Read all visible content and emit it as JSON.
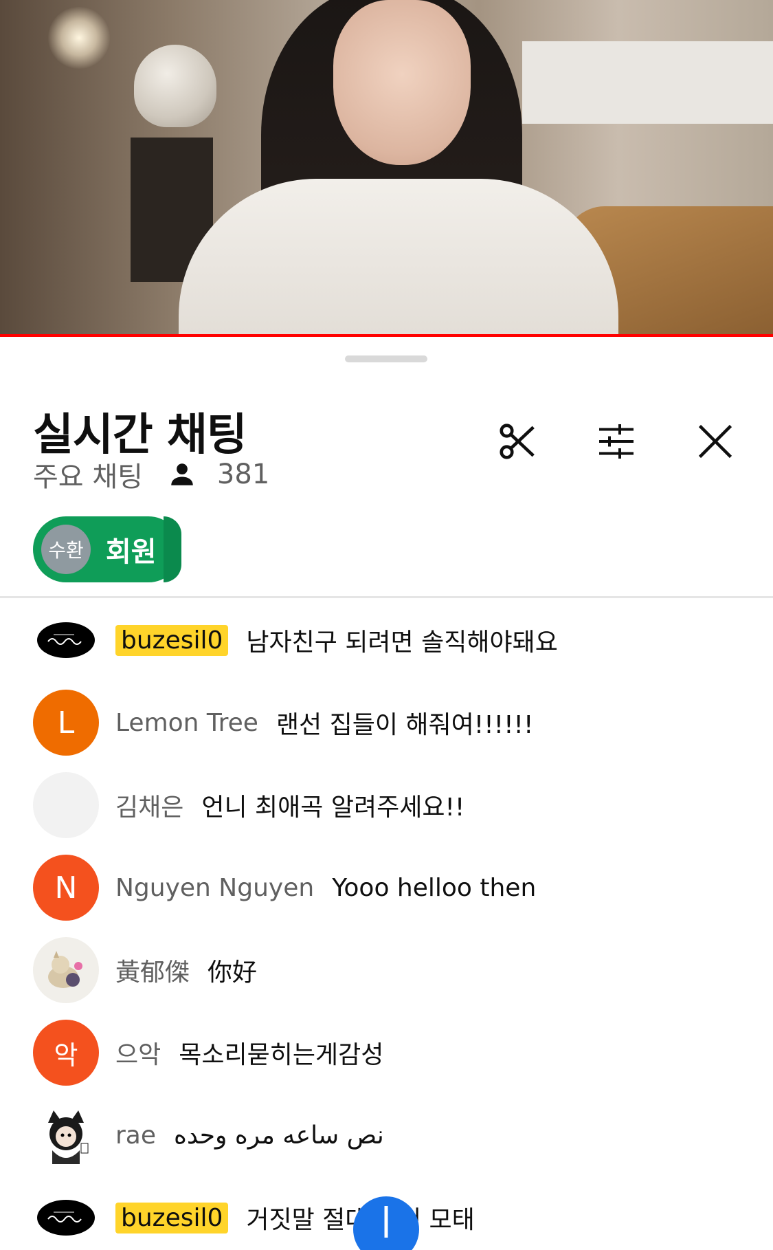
{
  "header": {
    "title": "실시간 채팅",
    "mode": "주요 채팅",
    "viewer_count": "381"
  },
  "filter_chip": {
    "avatar_text": "수환",
    "label": "회원"
  },
  "messages": [
    {
      "author": "buzesil0",
      "text": "남자친구 되려면 솔직해야돼요",
      "author_style": "owner",
      "avatar": {
        "type": "logo",
        "color": "#000000"
      }
    },
    {
      "author": "Lemon Tree",
      "text": "랜선 집들이 해줘여!!!!!!",
      "author_style": "normal",
      "avatar": {
        "type": "letter",
        "letter": "L",
        "color": "#ef6c00"
      }
    },
    {
      "author": "김채은",
      "text": "언니 최애곡 알려주세요!!",
      "author_style": "normal",
      "avatar": {
        "type": "blank",
        "color": "#f2f2f2"
      }
    },
    {
      "author": "Nguyen Nguyen",
      "text": "Yooo helloo then",
      "author_style": "normal",
      "avatar": {
        "type": "letter",
        "letter": "N",
        "color": "#f4511e"
      }
    },
    {
      "author": "黃郁傑",
      "text": "你好",
      "author_style": "normal",
      "avatar": {
        "type": "illustration",
        "color": "#f1efea"
      }
    },
    {
      "author": "으악",
      "text": "목소리묻히는게감성",
      "author_style": "normal",
      "avatar": {
        "type": "letter",
        "letter": "악",
        "color": "#f4511e"
      }
    },
    {
      "author": "rae",
      "text": "نص ساعه مره وحده",
      "author_style": "normal",
      "avatar": {
        "type": "illustration",
        "color": "#ffffff"
      }
    },
    {
      "author": "buzesil0",
      "text": "거짓말 절대 용서 모태",
      "author_style": "owner",
      "avatar": {
        "type": "logo",
        "color": "#000000"
      }
    }
  ],
  "colors": {
    "progress": "#ff0000",
    "chip": "#0f9d58",
    "owner_highlight": "#ffd42a",
    "fab": "#1a73e8"
  },
  "icons": {
    "clip": "scissors-icon",
    "tune": "sliders-icon",
    "close": "close-icon",
    "viewers": "person-icon",
    "fab": "arrow-down-icon"
  }
}
